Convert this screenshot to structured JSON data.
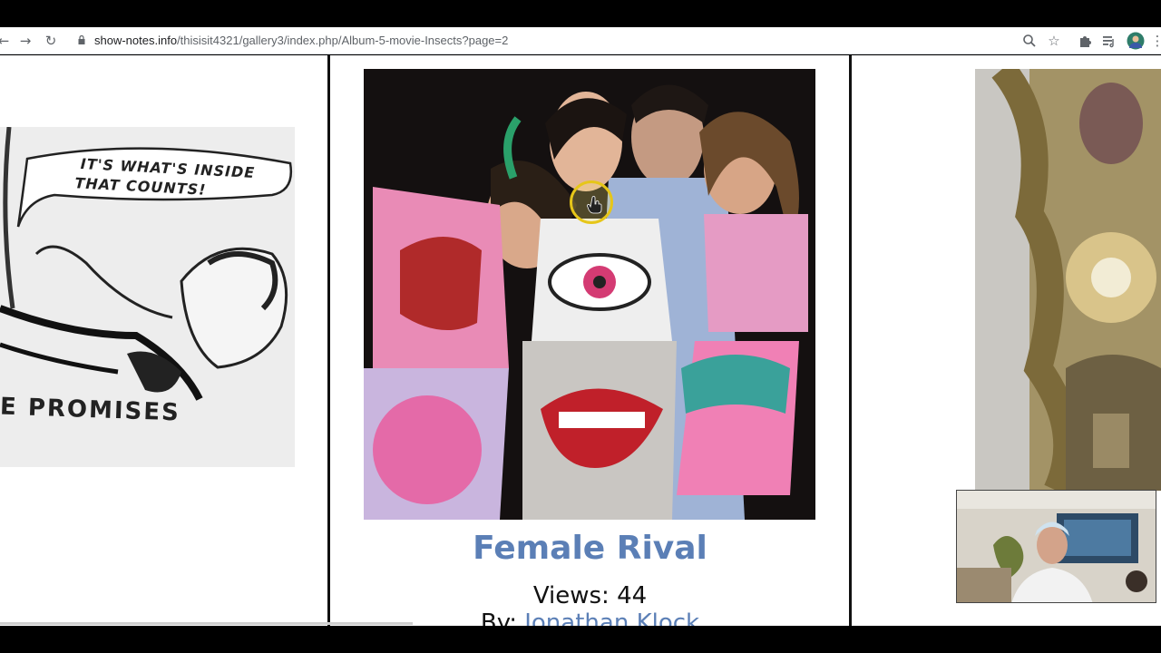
{
  "browser": {
    "url_host": "show-notes.info",
    "url_path": "/thisisit4321/gallery3/index.php/Album-5-movie-Insects?page=2",
    "icons": [
      "back-icon",
      "forward-icon",
      "reload-icon",
      "lock-icon",
      "zoom-icon",
      "bookmark-star-icon",
      "extensions-icon",
      "media-icon",
      "profile-avatar",
      "menu-icon"
    ]
  },
  "gallery": {
    "left_caption_top": "IT'S WHAT'S INSIDE",
    "left_caption_mid": "THAT COUNTS!",
    "left_caption_bottom": "E PROMISES",
    "item_title": "Female Rival",
    "views_text": "Views: 44",
    "by_label": "By: ",
    "author": "Jonathan Klock"
  },
  "colors": {
    "link": "#5b7fb6",
    "cursor_highlight": "#e6c619"
  }
}
